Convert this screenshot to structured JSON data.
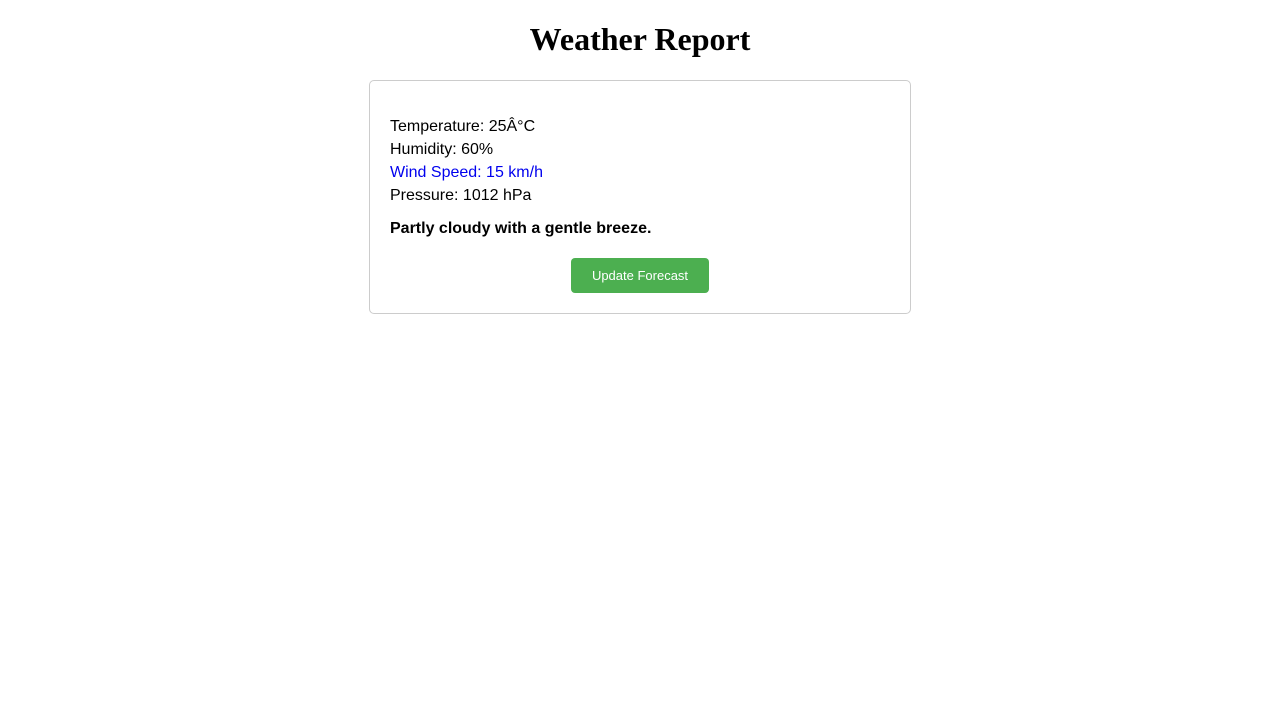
{
  "page": {
    "title": "Weather Report"
  },
  "weather": {
    "temperature": "Temperature: 25Â°C",
    "humidity": "Humidity: 60%",
    "wind_speed": "Wind Speed: 15 km/h",
    "pressure": "Pressure: 1012 hPa",
    "summary": "Partly cloudy with a gentle breeze."
  },
  "actions": {
    "update_label": "Update Forecast"
  },
  "colors": {
    "accent_button": "#4caf50",
    "highlight_text": "#0000ee",
    "card_border": "#cccccc"
  }
}
